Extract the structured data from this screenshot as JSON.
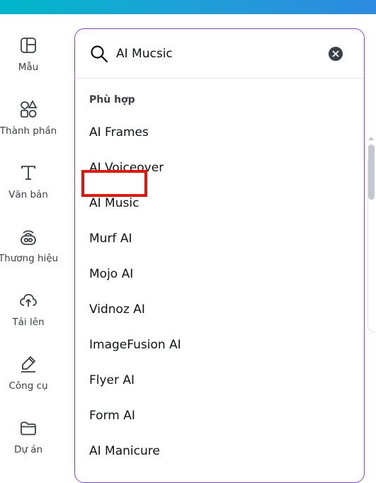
{
  "sidebar": {
    "items": [
      {
        "label": "Mẫu",
        "icon": "layout-icon"
      },
      {
        "label": "Thành phần",
        "icon": "shapes-icon"
      },
      {
        "label": "Văn bản",
        "icon": "text-icon"
      },
      {
        "label": "Thương hiệu",
        "icon": "brand-icon"
      },
      {
        "label": "Tải lên",
        "icon": "cloud-upload-icon"
      },
      {
        "label": "Công cụ",
        "icon": "pen-tool-icon"
      },
      {
        "label": "Dự án",
        "icon": "folder-icon"
      }
    ]
  },
  "search": {
    "value": "AI Mucsic",
    "icon": "search-icon",
    "clear_icon": "close-icon"
  },
  "results": {
    "section_label": "Phù hợp",
    "items": [
      "AI Frames",
      "AI Voiceover",
      "AI Music",
      "Murf AI",
      "Mojo AI",
      "Vidnoz AI",
      "ImageFusion AI",
      "Flyer AI",
      "Form AI",
      "AI Manicure"
    ],
    "highlighted": "AI Music"
  },
  "colors": {
    "accent": "#8b3dff",
    "highlight": "#e8140c",
    "text": "#0e1318",
    "muted": "#3a4047"
  }
}
